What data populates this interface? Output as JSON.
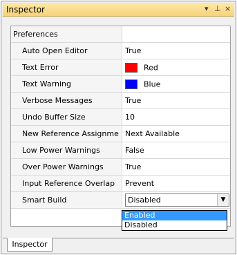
{
  "window": {
    "title": "Inspector",
    "icons": [
      "dropdown-arrow-icon",
      "pin-icon",
      "close-icon"
    ]
  },
  "grid": {
    "category": "Preferences",
    "rows": [
      {
        "name": "Auto Open Editor",
        "value": "True"
      },
      {
        "name": "Text Error",
        "value": "Red",
        "swatch": "#ff0000"
      },
      {
        "name": "Text Warning",
        "value": "Blue",
        "swatch": "#0000ff"
      },
      {
        "name": "Verbose Messages",
        "value": "True"
      },
      {
        "name": "Undo Buffer Size",
        "value": "10"
      },
      {
        "name": "New Reference Assignme",
        "value": "Next Available"
      },
      {
        "name": "Low Power Warnings",
        "value": "False"
      },
      {
        "name": "Over Power Warnings",
        "value": "True"
      },
      {
        "name": "Input Reference Overlap",
        "value": "Prevent"
      },
      {
        "name": "Smart Build",
        "value": "Disabled",
        "editor": "combo"
      }
    ]
  },
  "dropdown": {
    "options": [
      "Enabled",
      "Disabled"
    ],
    "highlighted": "Enabled"
  },
  "tabs": [
    {
      "label": "Inspector"
    }
  ]
}
